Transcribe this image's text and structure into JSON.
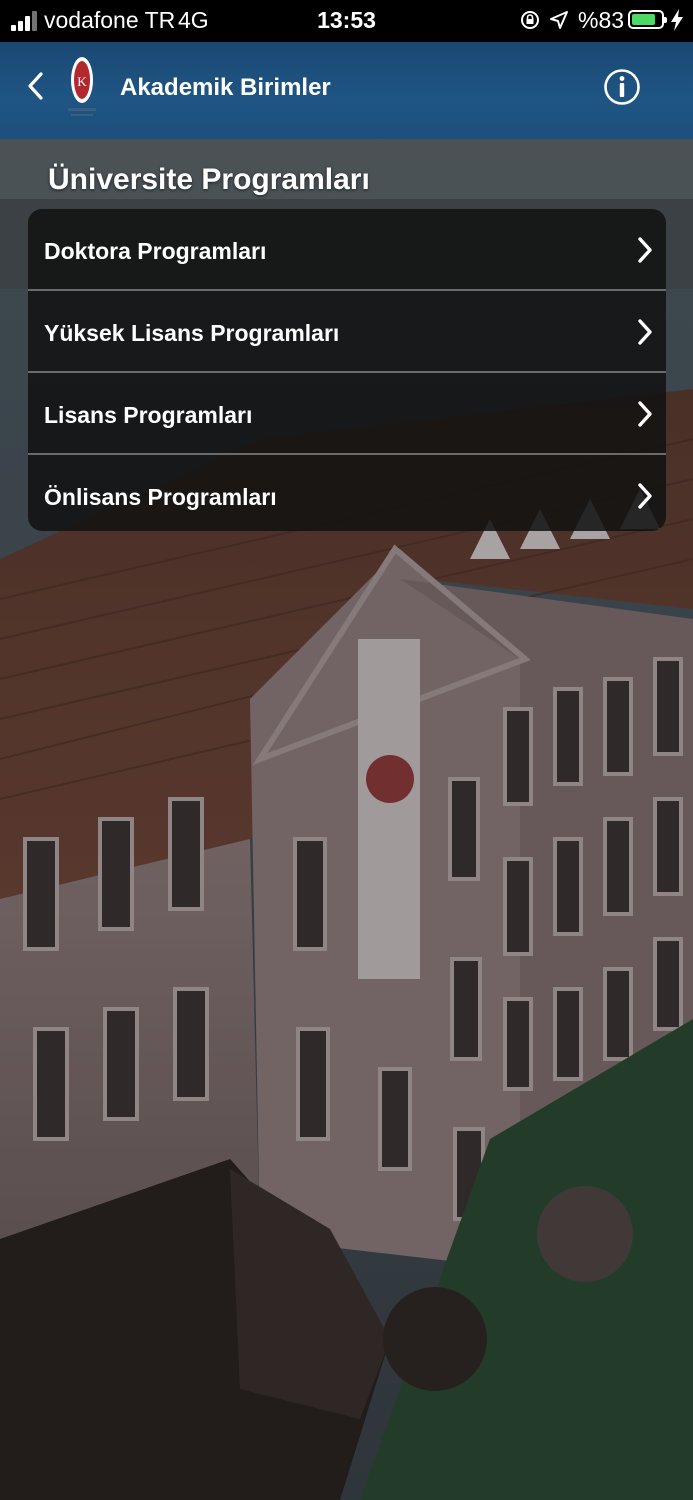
{
  "status_bar": {
    "carrier": "vodafone TR",
    "network": "4G",
    "time": "13:53",
    "battery_percent": "%83",
    "battery_level": 0.83,
    "battery_color": "#4cd964"
  },
  "navbar": {
    "title": "Akademik Birimler",
    "back_icon": "chevron-left-icon",
    "info_icon": "info-icon",
    "bar_color": "#1f5584"
  },
  "section": {
    "title": "Üniversite Programları"
  },
  "menu": {
    "items": [
      {
        "label": "Doktora Programları"
      },
      {
        "label": "Yüksek Lisans Programları"
      },
      {
        "label": "Lisans Programları"
      },
      {
        "label": "Önlisans Programları"
      }
    ]
  }
}
